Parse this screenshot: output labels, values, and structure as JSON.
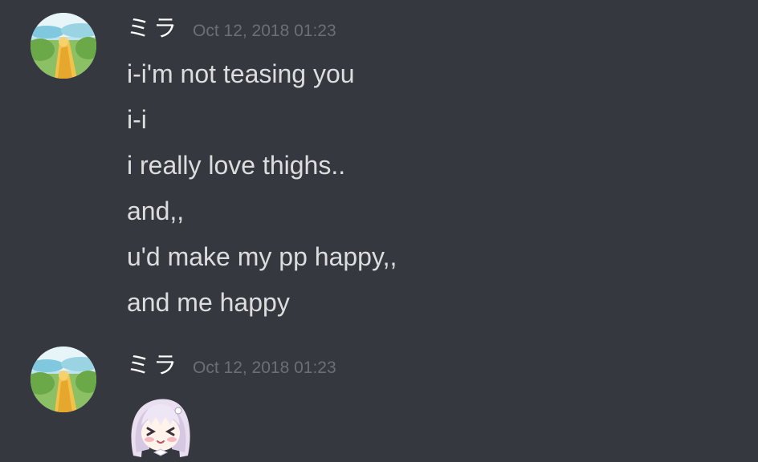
{
  "messages": [
    {
      "username": "ミラ",
      "timestamp": "Oct 12, 2018 01:23",
      "lines": [
        "i-i'm not teasing you",
        "i-i",
        "i really love thighs..",
        "and,,",
        "u'd make my pp happy,,",
        "and me happy"
      ]
    },
    {
      "username": "ミラ",
      "timestamp": "Oct 12, 2018 01:23",
      "emoji": "blushing-anime-girl-emoji"
    }
  ],
  "colors": {
    "background": "#36393f",
    "username": "#ffffff",
    "timestamp": "#6b6f76",
    "message_text": "#dcddde"
  }
}
